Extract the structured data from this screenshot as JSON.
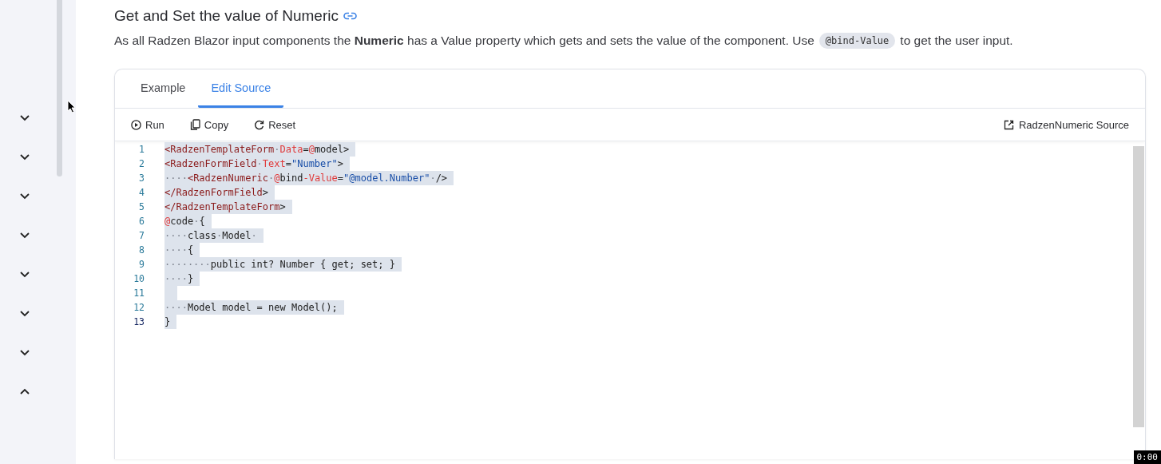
{
  "sidebar": {
    "items": [
      {
        "expanded": false
      },
      {
        "expanded": false
      },
      {
        "expanded": false
      },
      {
        "expanded": false
      },
      {
        "expanded": false
      },
      {
        "expanded": false
      },
      {
        "expanded": false
      },
      {
        "expanded": true
      }
    ]
  },
  "section": {
    "title": "Get and Set the value of Numeric",
    "description_parts": [
      {
        "kind": "text",
        "text": "As all Radzen Blazor input components the **Numeric** has a Value property which gets and sets the value of the component. Use"
      },
      {
        "kind": "code",
        "text": "@bind-Value"
      },
      {
        "kind": "text",
        "text": "to get the user input."
      }
    ]
  },
  "tabs": [
    {
      "label": "Example",
      "selected": false
    },
    {
      "label": "Edit Source",
      "selected": true
    }
  ],
  "toolbar": {
    "actions": [
      {
        "kind": "run",
        "label": "Run"
      },
      {
        "kind": "copy",
        "label": "Copy"
      },
      {
        "kind": "reset",
        "label": "Reset"
      }
    ],
    "source_link": "RadzenNumeric Source"
  },
  "code": {
    "lines": [
      {
        "number": "1",
        "current": false,
        "tokens": [
          {
            "kind": "tag",
            "text": "<RadzenTemplateForm"
          },
          {
            "kind": "ws",
            "text": "·"
          },
          {
            "kind": "attr",
            "text": "Data"
          },
          {
            "kind": "plain",
            "text": "="
          },
          {
            "kind": "at",
            "text": "@"
          },
          {
            "kind": "plain",
            "text": "model>"
          }
        ]
      },
      {
        "number": "2",
        "current": false,
        "tokens": [
          {
            "kind": "tag",
            "text": "<RadzenFormField"
          },
          {
            "kind": "ws",
            "text": "·"
          },
          {
            "kind": "attr",
            "text": "Text"
          },
          {
            "kind": "plain",
            "text": "="
          },
          {
            "kind": "str",
            "text": "\"Number\""
          },
          {
            "kind": "plain",
            "text": ">"
          }
        ]
      },
      {
        "number": "3",
        "current": false,
        "tokens": [
          {
            "kind": "ws",
            "text": "····"
          },
          {
            "kind": "tag",
            "text": "<RadzenNumeric"
          },
          {
            "kind": "ws",
            "text": "·"
          },
          {
            "kind": "at",
            "text": "@"
          },
          {
            "kind": "plain",
            "text": "bind"
          },
          {
            "kind": "attr",
            "text": "-Value"
          },
          {
            "kind": "plain",
            "text": "="
          },
          {
            "kind": "str",
            "text": "\"@model.Number\""
          },
          {
            "kind": "ws",
            "text": "·"
          },
          {
            "kind": "plain",
            "text": "/>"
          }
        ]
      },
      {
        "number": "4",
        "current": false,
        "tokens": [
          {
            "kind": "tag",
            "text": "</RadzenFormField"
          },
          {
            "kind": "plain",
            "text": ">"
          }
        ]
      },
      {
        "number": "5",
        "current": false,
        "tokens": [
          {
            "kind": "tag",
            "text": "</RadzenTemplateForm"
          },
          {
            "kind": "plain",
            "text": ">"
          }
        ]
      },
      {
        "number": "6",
        "current": false,
        "tokens": [
          {
            "kind": "at",
            "text": "@"
          },
          {
            "kind": "plain",
            "text": "code"
          },
          {
            "kind": "ws",
            "text": "·"
          },
          {
            "kind": "plain",
            "text": "{"
          }
        ]
      },
      {
        "number": "7",
        "current": false,
        "tokens": [
          {
            "kind": "ws",
            "text": "····"
          },
          {
            "kind": "plain",
            "text": "class"
          },
          {
            "kind": "ws",
            "text": "·"
          },
          {
            "kind": "plain",
            "text": "Model"
          },
          {
            "kind": "ws",
            "text": "·"
          }
        ]
      },
      {
        "number": "8",
        "current": false,
        "tokens": [
          {
            "kind": "ws",
            "text": "····"
          },
          {
            "kind": "plain",
            "text": "{"
          }
        ]
      },
      {
        "number": "9",
        "current": false,
        "tokens": [
          {
            "kind": "ws",
            "text": "········"
          },
          {
            "kind": "plain",
            "text": "public int? Number { get; set; }"
          }
        ]
      },
      {
        "number": "10",
        "current": false,
        "tokens": [
          {
            "kind": "ws",
            "text": "····"
          },
          {
            "kind": "plain",
            "text": "}"
          }
        ]
      },
      {
        "number": "11",
        "current": false
      },
      {
        "number": "12",
        "current": false,
        "tokens": [
          {
            "kind": "ws",
            "text": "····"
          },
          {
            "kind": "plain",
            "text": "Model model = new Model();"
          }
        ]
      },
      {
        "number": "13",
        "current": true,
        "tokens": [
          {
            "kind": "plain",
            "text": "}"
          }
        ]
      }
    ]
  },
  "recording_timer": "0:00"
}
